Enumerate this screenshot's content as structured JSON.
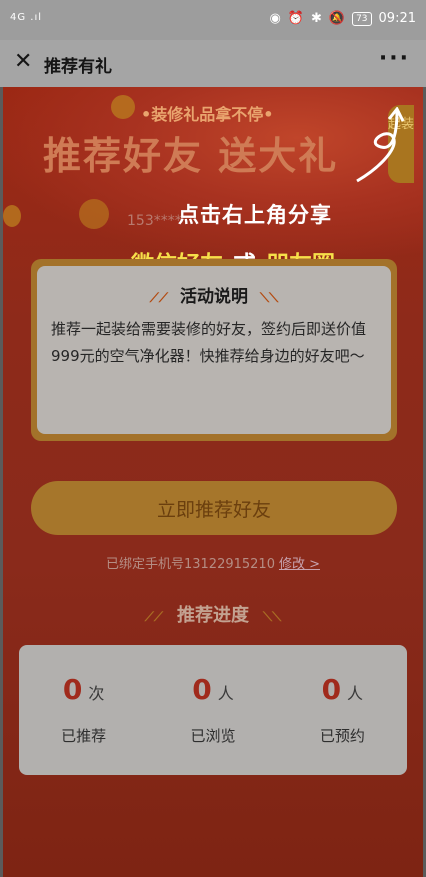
{
  "status_bar": {
    "signal": "4G .ıl",
    "battery": "73",
    "time": "09:21"
  },
  "navbar": {
    "title": "推荐有礼",
    "close": "✕",
    "more": "···"
  },
  "banner": {
    "slogan": "•装修礼品拿不停•",
    "title": "推荐好友 送大礼",
    "masked_phone": "153****",
    "side_tab": "起装"
  },
  "overlay": {
    "share_hint": "点击右上角分享",
    "wechat_friends": "微信好友",
    "or": "或",
    "moments": "朋友圈"
  },
  "activity": {
    "title": "活动说明",
    "text": "推荐一起装给需要装修的好友，签约后即送价值999元的空气净化器！快推荐给身边的好友吧～"
  },
  "cta": {
    "label": "立即推荐好友"
  },
  "bound_phone": {
    "text": "已绑定手机号13122915210",
    "edit": "修改 >"
  },
  "progress": {
    "title": "推荐进度",
    "stats": [
      {
        "value": "0",
        "unit": "次",
        "label": "已推荐"
      },
      {
        "value": "0",
        "unit": "人",
        "label": "已浏览"
      },
      {
        "value": "0",
        "unit": "人",
        "label": "已预约"
      }
    ]
  },
  "colors": {
    "page_bg": "#8e2a1a",
    "gold": "#a6762b",
    "highlight_yellow": "#f6e04a"
  }
}
